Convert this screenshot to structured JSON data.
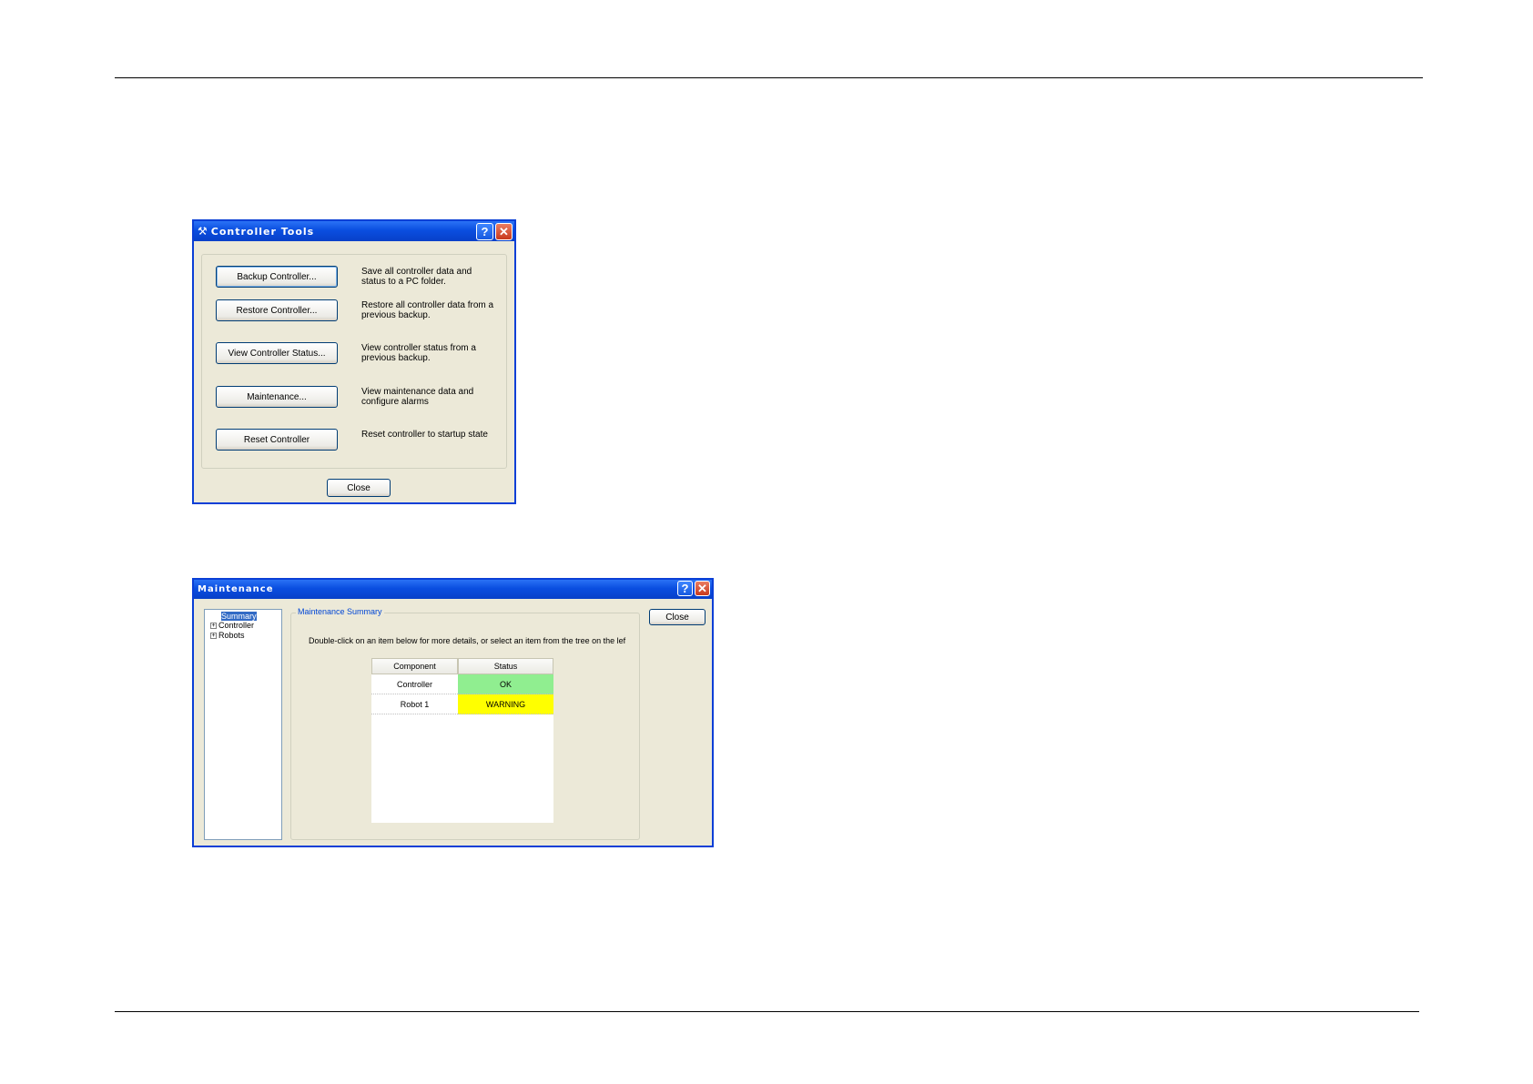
{
  "controller_tools": {
    "title": "Controller Tools",
    "help_icon": "?",
    "close_icon": "✕",
    "buttons": [
      {
        "label": "Backup Controller...",
        "description": "Save all controller data and status to a PC folder."
      },
      {
        "label": "Restore Controller...",
        "description": "Restore all controller data from a previous backup."
      },
      {
        "label": "View Controller Status...",
        "description": "View controller status from a previous backup."
      },
      {
        "label": "Maintenance...",
        "description": "View maintenance data and configure alarms"
      },
      {
        "label": "Reset Controller",
        "description": "Reset controller to startup state"
      }
    ],
    "close_label": "Close"
  },
  "maintenance": {
    "title": "Maintenance",
    "help_icon": "?",
    "close_icon": "✕",
    "close_label": "Close",
    "tree": [
      {
        "label": "Summary",
        "toggle": ""
      },
      {
        "label": "Controller",
        "toggle": "+"
      },
      {
        "label": "Robots",
        "toggle": "+"
      }
    ],
    "group_title": "Maintenance Summary",
    "instructions": "Double-click on an item below for more details, or select an item from the tree on the lef",
    "table": {
      "headers": [
        "Component",
        "Status"
      ],
      "rows": [
        {
          "component": "Controller",
          "status": "OK",
          "color": "#90ee90"
        },
        {
          "component": "Robot 1",
          "status": "WARNING",
          "color": "#ffff00"
        }
      ]
    }
  }
}
